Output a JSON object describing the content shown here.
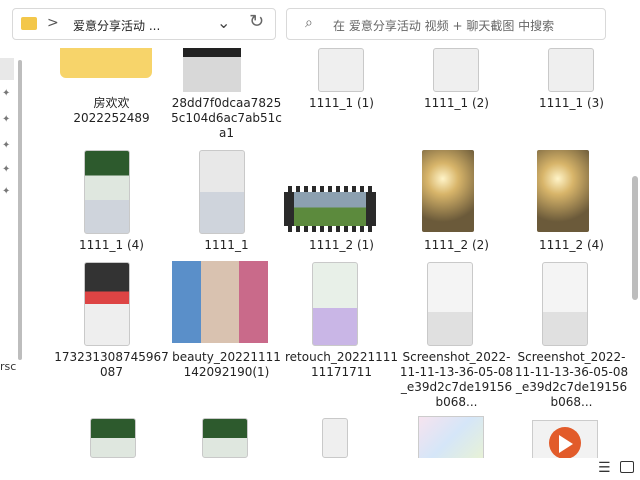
{
  "address_bar": {
    "chevron": ">",
    "path": "爱意分享活动 ...",
    "dropdown": "⌄",
    "refresh": "↻"
  },
  "search": {
    "icon": "⌕",
    "placeholder": "在 爱意分享活动 视频 + 聊天截图 中搜索"
  },
  "nav_pane": {
    "partial_text": "rsc"
  },
  "files": [
    {
      "label": "房欢欢\n2022252489"
    },
    {
      "label": "28dd7f0dcaa78255c104d6ac7ab51ca1"
    },
    {
      "label": "1111_1 (1)"
    },
    {
      "label": "1111_1 (2)"
    },
    {
      "label": "1111_1 (3)"
    },
    {
      "label": "1111_1 (4)"
    },
    {
      "label": "1111_1"
    },
    {
      "label": "1111_2 (1)"
    },
    {
      "label": "1111_2 (2)"
    },
    {
      "label": "1111_2 (4)"
    },
    {
      "label": "173231308745967087"
    },
    {
      "label": "beauty_20221111142092190(1)"
    },
    {
      "label": "retouch_2022111111171711"
    },
    {
      "label": "Screenshot_2022-11-11-13-36-05-08_e39d2c7de19156b068..."
    },
    {
      "label": "Screenshot_2022-11-11-13-36-05-08_e39d2c7de19156b068..."
    }
  ],
  "statusbar": {
    "details_icon": "details-view-icon",
    "tiles_icon": "large-icons-view-icon"
  }
}
